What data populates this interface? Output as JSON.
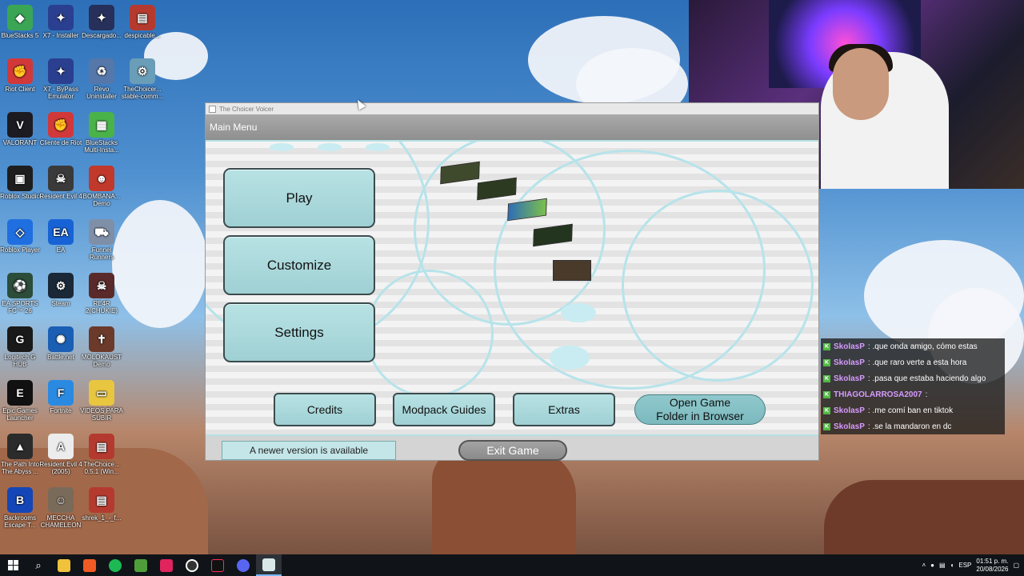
{
  "desktop": {
    "icons": [
      {
        "label": "BlueStacks 5",
        "color": "#3aa655",
        "glyph": "◆"
      },
      {
        "label": "X7 - Installer",
        "color": "#2a3f8f",
        "glyph": "✦"
      },
      {
        "label": "Descargado...",
        "color": "#26305a",
        "glyph": "✦"
      },
      {
        "label": "despicable...",
        "color": "#b43a2f",
        "glyph": "▤"
      },
      {
        "label": "Riot Client",
        "color": "#d1383a",
        "glyph": "✊"
      },
      {
        "label": "X7 - ByPass Emulator",
        "color": "#2a3f8f",
        "glyph": "✦"
      },
      {
        "label": "Revo Uninstaller",
        "color": "#5577aa",
        "glyph": "♻"
      },
      {
        "label": "TheChoicer... stable-comm...",
        "color": "#6a9db8",
        "glyph": "⚙"
      },
      {
        "label": "VALORANT",
        "color": "#1d1b22",
        "glyph": "V"
      },
      {
        "label": "Cliente de Riot",
        "color": "#d1383a",
        "glyph": "✊"
      },
      {
        "label": "BlueStacks Multi-Insta...",
        "color": "#49b34a",
        "glyph": "▦"
      },
      {
        "label": "Roblox Studio",
        "color": "#1e1e1e",
        "glyph": "▣"
      },
      {
        "label": "Resident Evil 4",
        "color": "#3a3a3a",
        "glyph": "☠"
      },
      {
        "label": "BOMBANA... Demo",
        "color": "#c0392b",
        "glyph": "☻"
      },
      {
        "label": "Roblox Player",
        "color": "#1f6fe0",
        "glyph": "◇"
      },
      {
        "label": "EA",
        "color": "#1763d6",
        "glyph": "EA"
      },
      {
        "label": "Funnel Runners",
        "color": "#7f8fa8",
        "glyph": "⛟"
      },
      {
        "label": "EA SPORTS FC™ 26",
        "color": "#2b4d3a",
        "glyph": "⚽"
      },
      {
        "label": "Steam",
        "color": "#1b2838",
        "glyph": "⚙"
      },
      {
        "label": "RE4R 2(CHUKIE)",
        "color": "#5a2a2a",
        "glyph": "☠"
      },
      {
        "label": "Logitech G HUB",
        "color": "#1a1a1a",
        "glyph": "G"
      },
      {
        "label": "Battle.net",
        "color": "#1a5fb4",
        "glyph": "✺"
      },
      {
        "label": "MOLOKAUST Demo",
        "color": "#6b3a2a",
        "glyph": "✝"
      },
      {
        "label": "Epic Games Launcher",
        "color": "#111111",
        "glyph": "E"
      },
      {
        "label": "Fortnite",
        "color": "#2a8ae2",
        "glyph": "F"
      },
      {
        "label": "VIDEOS PARA SUBIR",
        "color": "#e8c640",
        "glyph": "▭"
      },
      {
        "label": "The Path Into The Abyss ...",
        "color": "#2b2b2b",
        "glyph": "▲"
      },
      {
        "label": "Resident Evil 4 (2005)",
        "color": "#ececec",
        "glyph": "A"
      },
      {
        "label": "TheChoice... 0.5.1 (Win...",
        "color": "#b43a2f",
        "glyph": "▤"
      },
      {
        "label": "Backrooms Escape T...",
        "color": "#1446b8",
        "glyph": "B"
      },
      {
        "label": "MECCHA CHAMELEON",
        "color": "#7a6a5a",
        "glyph": "☺"
      },
      {
        "label": "shrek_1_-_f...",
        "color": "#b43a2f",
        "glyph": "▤"
      }
    ]
  },
  "app": {
    "window_title": "The Choicer Voicer",
    "header": "Main Menu",
    "buttons": {
      "play": "Play",
      "customize": "Customize",
      "settings": "Settings",
      "credits": "Credits",
      "modpack_guides": "Modpack Guides",
      "extras": "Extras",
      "open_folder_line1": "Open Game",
      "open_folder_line2": "Folder in Browser",
      "exit": "Exit Game"
    },
    "notice": "A newer version is available",
    "colors": {
      "button": "#a8d8dc",
      "accent": "#b6e0e4",
      "header": "#999999"
    }
  },
  "chat": [
    {
      "user": "SkolasP",
      "message": ": .que onda amigo, cómo estas",
      "color": "#d79bff"
    },
    {
      "user": "SkolasP",
      "message": ": .que raro verte a esta hora",
      "color": "#d79bff"
    },
    {
      "user": "SkolasP",
      "message": ": .pasa que estaba haciendo algo",
      "color": "#d79bff"
    },
    {
      "user": "THIAGOLARROSA2007",
      "message": ":",
      "color": "#d79bff"
    },
    {
      "user": "SkolasP",
      "message": ": .me comí ban en tiktok",
      "color": "#d79bff"
    },
    {
      "user": "SkolasP",
      "message": ": .se la mandaron en dc",
      "color": "#d79bff"
    }
  ],
  "taskbar": {
    "language": "ESP",
    "time": "01:51 p. m.",
    "date": "20/08/2026"
  }
}
